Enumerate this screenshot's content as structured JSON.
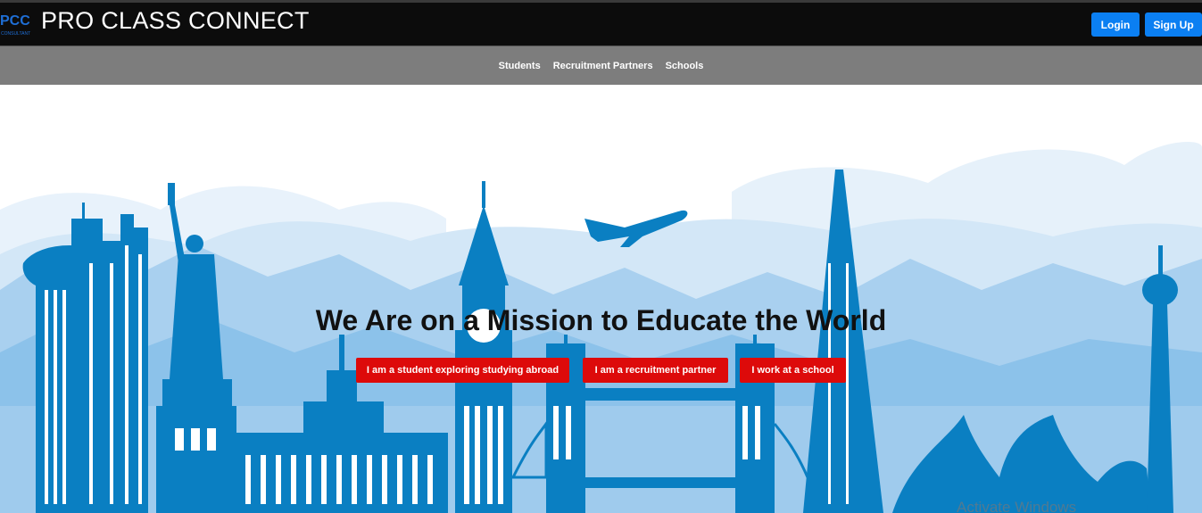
{
  "header": {
    "brand": "PRO CLASS CONNECT",
    "logo_text": "PCC",
    "logo_subtext": "CONSULTANT",
    "login_label": "Login",
    "signup_label": "Sign Up"
  },
  "nav": {
    "items": [
      {
        "label": "Students"
      },
      {
        "label": "Recruitment Partners"
      },
      {
        "label": "Schools"
      }
    ]
  },
  "hero": {
    "headline": "We Are on a Mission to Educate the World",
    "buttons": [
      {
        "label": "I am a student exploring studying abroad"
      },
      {
        "label": "I am a recruitment partner"
      },
      {
        "label": "I work at a school"
      }
    ]
  },
  "os_watermark": "Activate Windows",
  "colors": {
    "header_bg": "#0c0c0c",
    "nav_bg": "#7d7d7d",
    "primary_button": "#0b7ff2",
    "cta_button": "#dd0a0a",
    "skyline_blue": "#0a7fc2"
  }
}
